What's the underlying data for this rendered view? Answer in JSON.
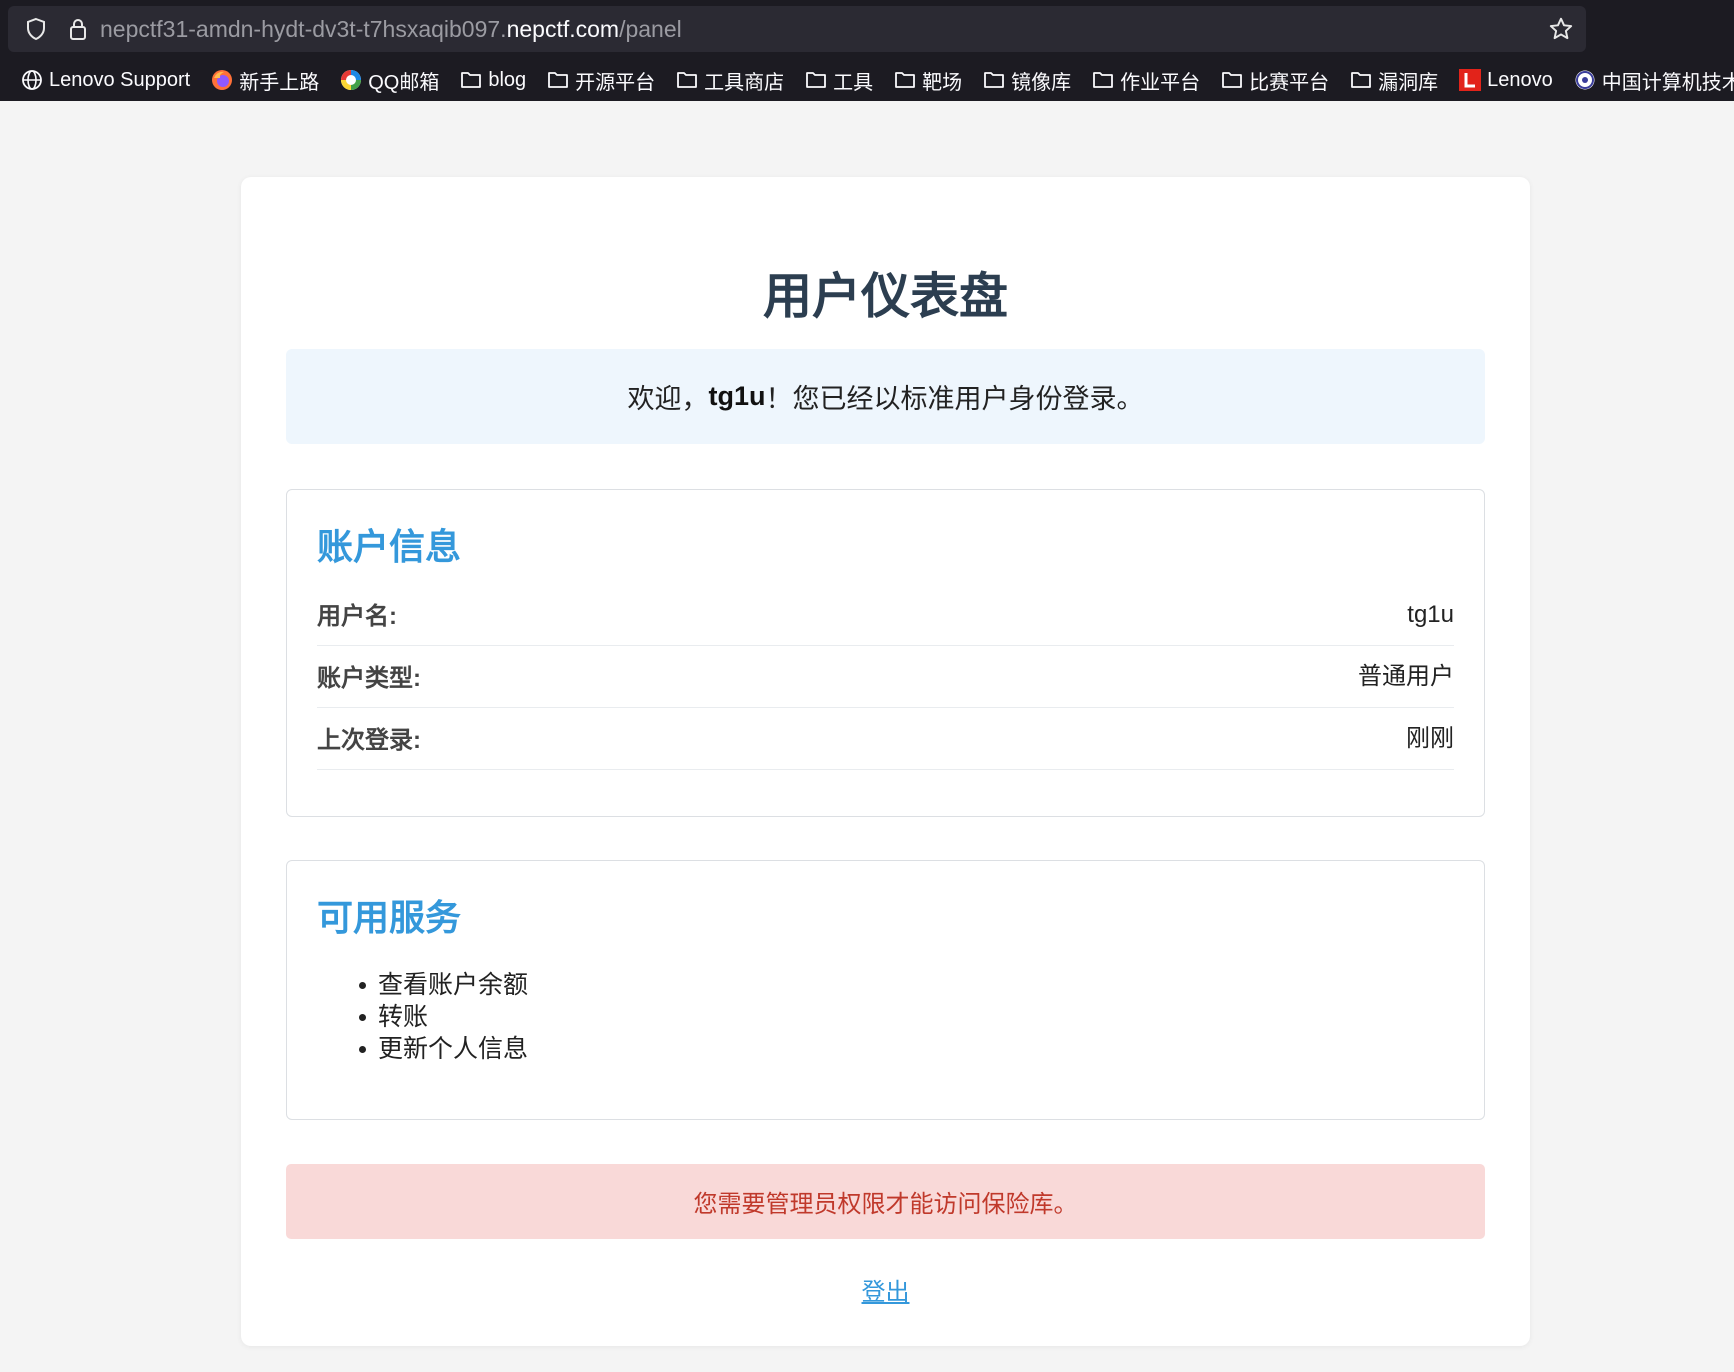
{
  "browser": {
    "url_prefix": "nepctf31-amdn-hydt-dv3t-t7hsxaqib097.",
    "url_domain": "nepctf.com",
    "url_path": "/panel",
    "bookmarks": [
      {
        "label": "Lenovo Support",
        "icon": "globe-icon"
      },
      {
        "label": "新手上路",
        "icon": "firefox-icon"
      },
      {
        "label": "QQ邮箱",
        "icon": "qqmail-icon"
      },
      {
        "label": "blog",
        "icon": "folder-icon"
      },
      {
        "label": "开源平台",
        "icon": "folder-icon"
      },
      {
        "label": "工具商店",
        "icon": "folder-icon"
      },
      {
        "label": "工具",
        "icon": "folder-icon"
      },
      {
        "label": "靶场",
        "icon": "folder-icon"
      },
      {
        "label": "镜像库",
        "icon": "folder-icon"
      },
      {
        "label": "作业平台",
        "icon": "folder-icon"
      },
      {
        "label": "比赛平台",
        "icon": "folder-icon"
      },
      {
        "label": "漏洞库",
        "icon": "folder-icon"
      },
      {
        "label": "Lenovo",
        "icon": "lenovo-icon"
      },
      {
        "label": "中国计算机技术职业...",
        "icon": "site-icon"
      }
    ]
  },
  "page": {
    "title": "用户仪表盘",
    "welcome": {
      "prefix": "欢迎，",
      "username": "tg1u",
      "suffix": "！您已经以标准用户身份登录。"
    },
    "account": {
      "heading": "账户信息",
      "rows": [
        {
          "label": "用户名:",
          "value": "tg1u"
        },
        {
          "label": "账户类型:",
          "value": "普通用户"
        },
        {
          "label": "上次登录:",
          "value": "刚刚"
        }
      ]
    },
    "services": {
      "heading": "可用服务",
      "items": [
        "查看账户余额",
        "转账",
        "更新个人信息"
      ]
    },
    "alert": "您需要管理员权限才能访问保险库。",
    "logout": "登出"
  },
  "colors": {
    "heading_blue": "#3498db",
    "title": "#2c3e50",
    "alert_bg": "#f9d9d8",
    "alert_text": "#c0392b",
    "welcome_bg": "#eef6fd"
  }
}
